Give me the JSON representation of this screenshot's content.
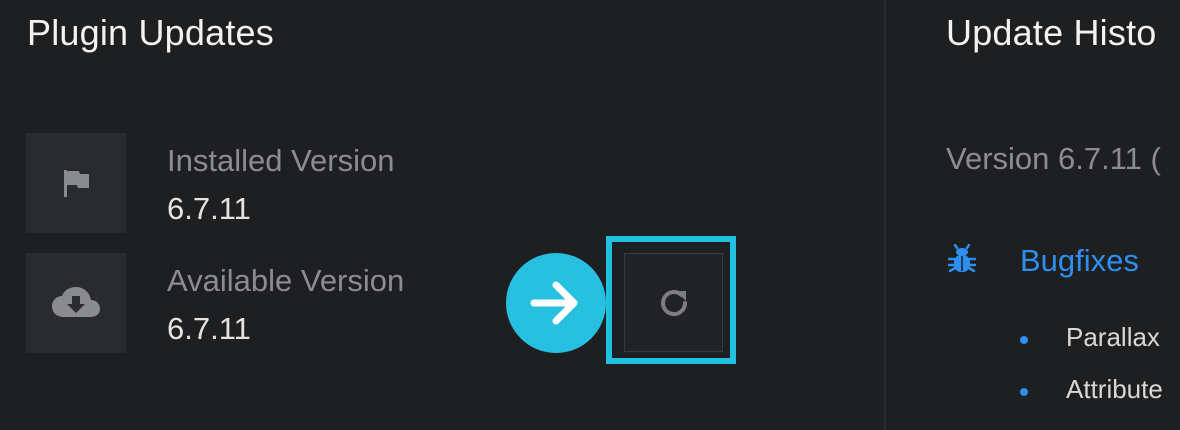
{
  "plugin_updates": {
    "title": "Plugin Updates",
    "installed": {
      "label": "Installed Version",
      "value": "6.7.11",
      "icon": "flag-icon"
    },
    "available": {
      "label": "Available Version",
      "value": "6.7.11",
      "icon": "cloud-download-icon"
    },
    "refresh_icon": "refresh-icon",
    "arrow_icon": "arrow-right-icon"
  },
  "update_history": {
    "title": "Update Histo",
    "version_line": "Version 6.7.11 (",
    "bugfixes": {
      "icon": "bug-icon",
      "heading": "Bugfixes",
      "items": [
        "Parallax",
        "Attribute"
      ]
    }
  },
  "colors": {
    "background": "#1e1f21",
    "accent_cyan": "#22c0e0",
    "link_blue": "#2d8ff0",
    "muted_text": "#8c8d90"
  }
}
